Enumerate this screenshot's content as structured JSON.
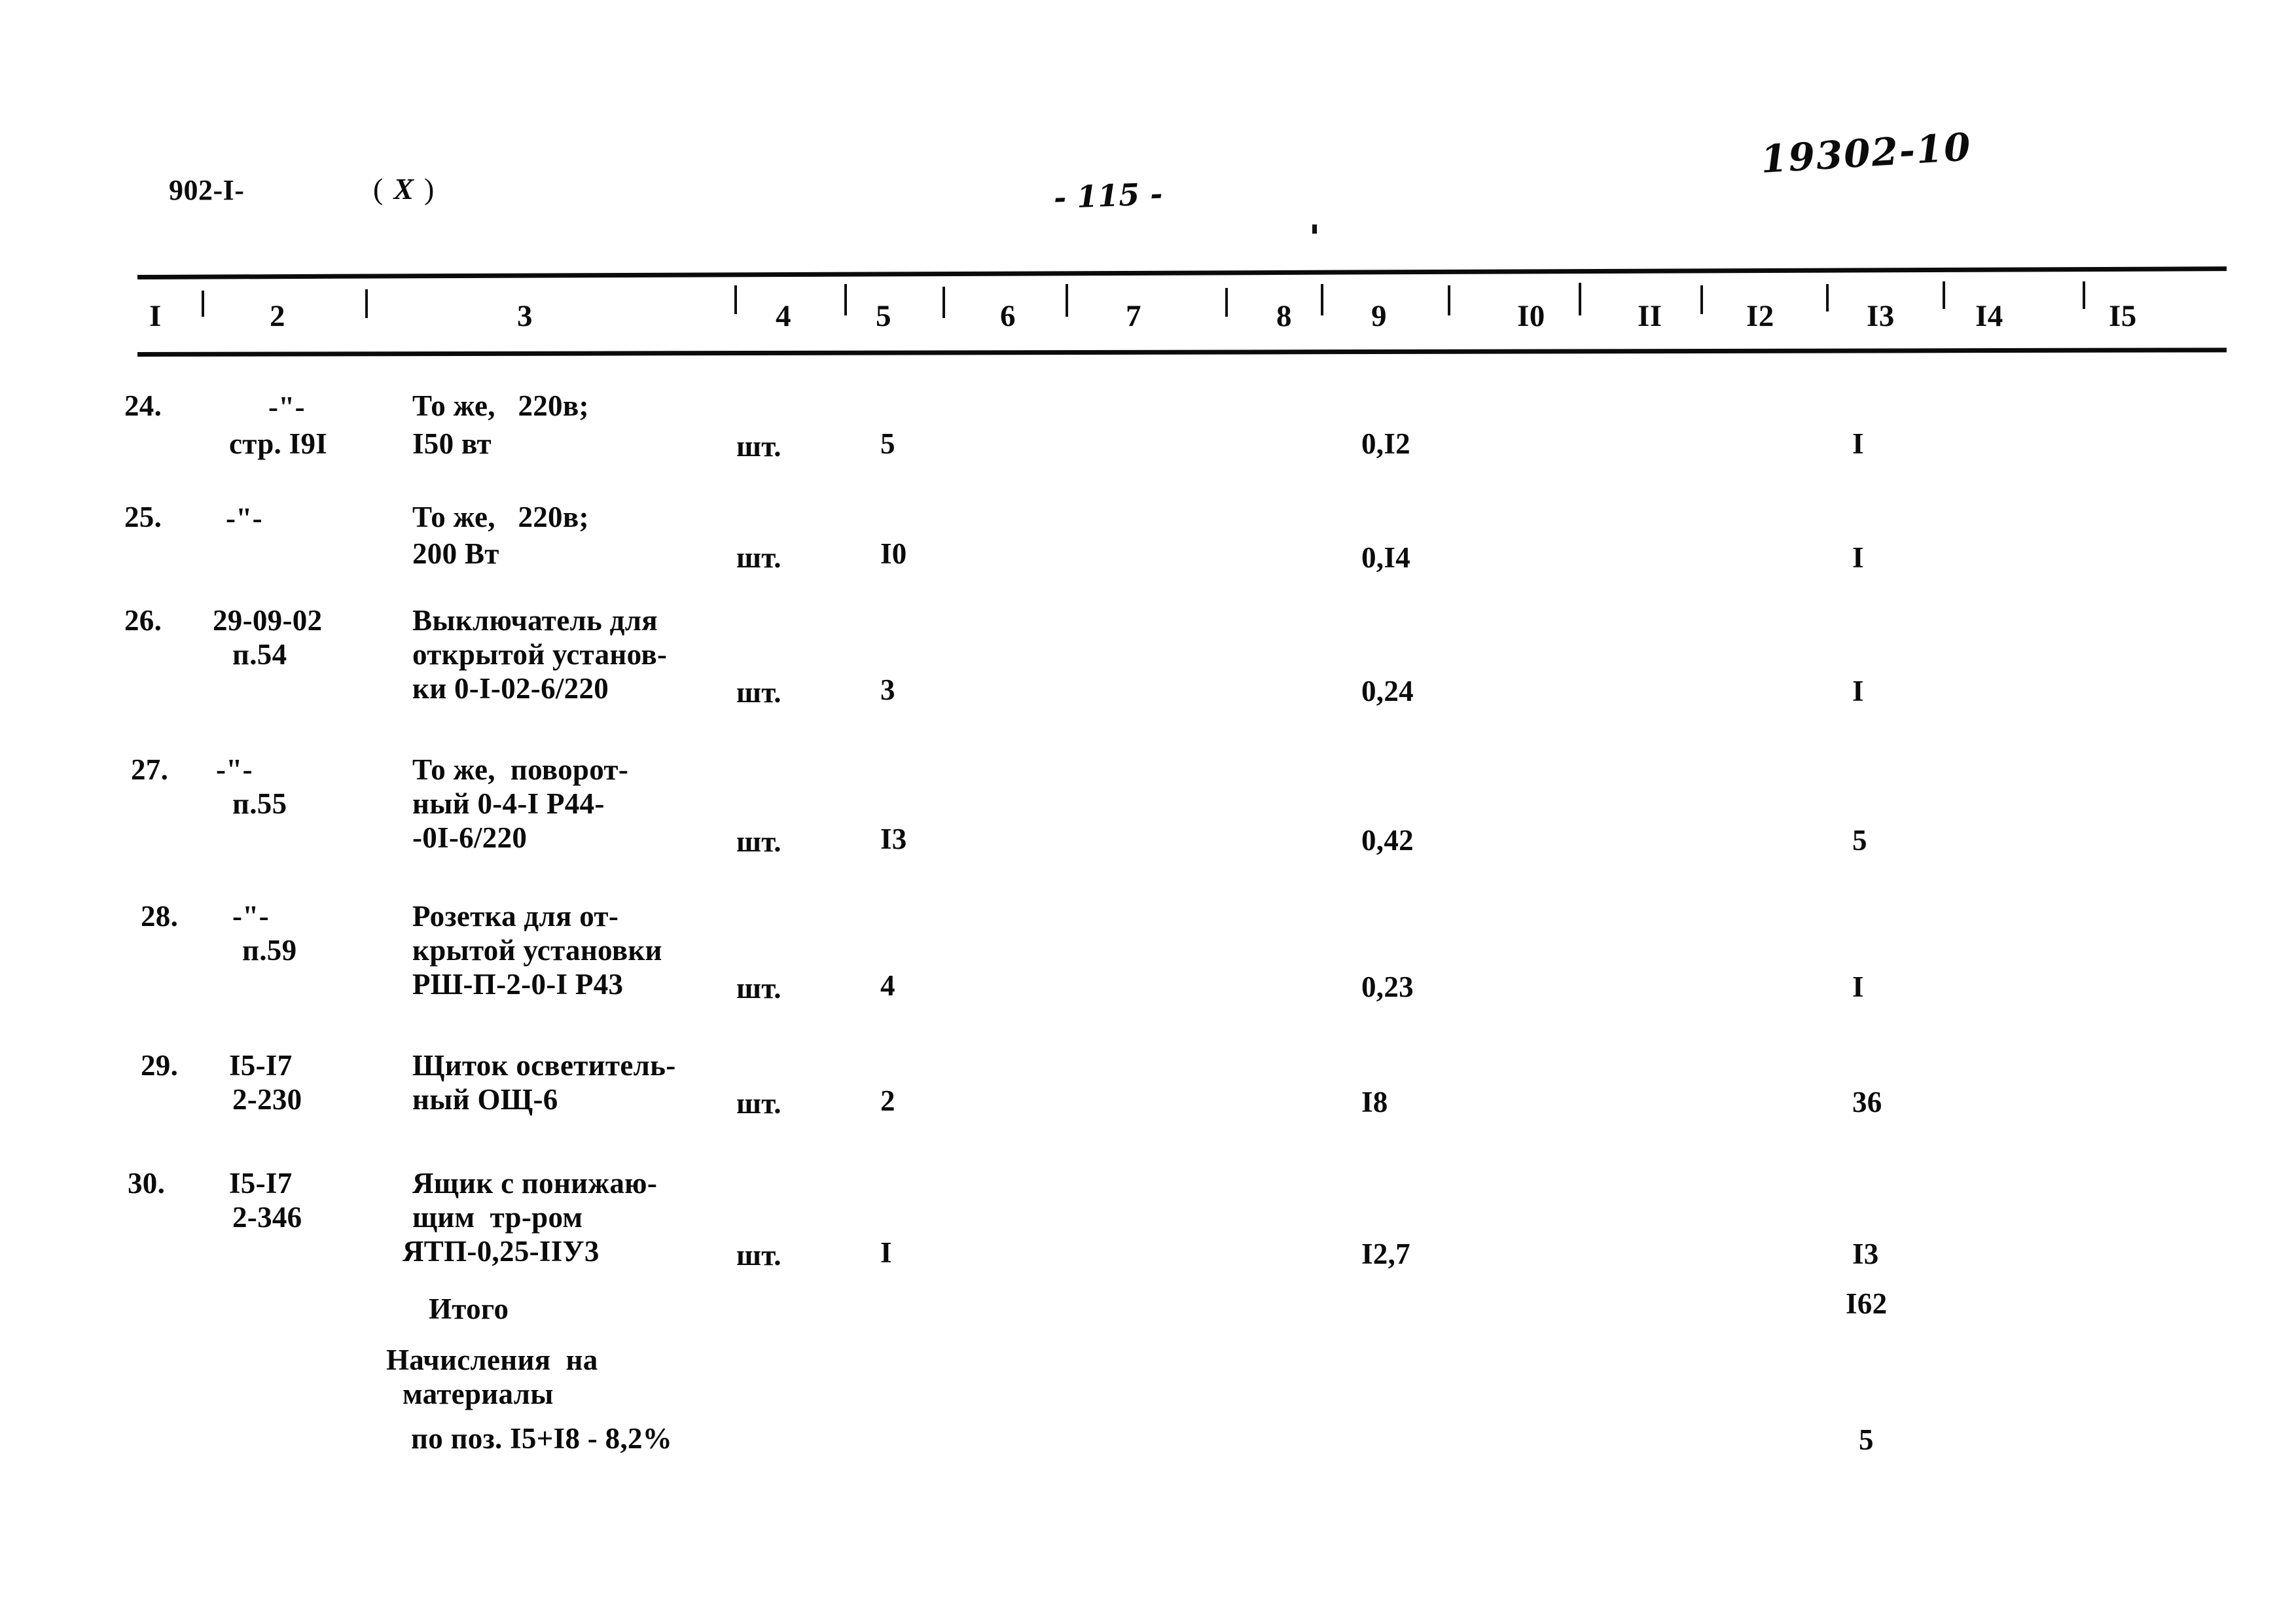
{
  "header": {
    "doc_code": "902-I-",
    "variant_open": "(",
    "variant_value": "X",
    "variant_close": ")",
    "page_number": "- 115 -",
    "hand_number": "19302-10"
  },
  "table": {
    "column_headers": [
      "I",
      "2",
      "3",
      "4",
      "5",
      "6",
      "7",
      "8",
      "9",
      "I0",
      "II",
      "I2",
      "I3",
      "I4",
      "I5"
    ],
    "rows": [
      {
        "num": "24.",
        "code_line1": "-\"-",
        "code_line2": "стр. I9I",
        "name_line1": "То же,   220в;",
        "name_line2": "I50 вт",
        "name_line3": "",
        "unit": "шт.",
        "qty": "5",
        "col9": "0,I2",
        "col13": "I"
      },
      {
        "num": "25.",
        "code_line1": "-\"-",
        "code_line2": "",
        "name_line1": "То же,   220в;",
        "name_line2": "200 Вт",
        "name_line3": "",
        "unit": "шт.",
        "qty": "I0",
        "col9": "0,I4",
        "col13": "I"
      },
      {
        "num": "26.",
        "code_line1": "29-09-02",
        "code_line2": "п.54",
        "name_line1": "Выключатель для",
        "name_line2": "открытой установ-",
        "name_line3": "ки 0-I-02-6/220",
        "unit": "шт.",
        "qty": "3",
        "col9": "0,24",
        "col13": "I"
      },
      {
        "num": "27.",
        "code_line1": "-\"-",
        "code_line2": "п.55",
        "name_line1": "То же,  поворот-",
        "name_line2": "ный 0-4-I Р44-",
        "name_line3": "-0I-6/220",
        "unit": "шт.",
        "qty": "I3",
        "col9": "0,42",
        "col13": "5"
      },
      {
        "num": "28.",
        "code_line1": "-\"-",
        "code_line2": "п.59",
        "name_line1": "Розетка для от-",
        "name_line2": "крытой установки",
        "name_line3": "РШ-П-2-0-I Р43",
        "unit": "шт.",
        "qty": "4",
        "col9": "0,23",
        "col13": "I"
      },
      {
        "num": "29.",
        "code_line1": "I5-I7",
        "code_line2": "2-230",
        "name_line1": "Щиток осветитель-",
        "name_line2": "ный ОЩ-6",
        "name_line3": "",
        "unit": "шт.",
        "qty": "2",
        "col9": "I8",
        "col13": "36"
      },
      {
        "num": "30.",
        "code_line1": "I5-I7",
        "code_line2": "2-346",
        "name_line1": "Ящик с понижаю-",
        "name_line2": "щим  тр-ром",
        "name_line3": "ЯТП-0,25-IIУ3",
        "unit": "шт.",
        "qty": "I",
        "col9": "I2,7",
        "col13": "I3"
      }
    ],
    "summary": [
      {
        "label": "Итого",
        "col13": "I62"
      },
      {
        "label_line1": "Начисления  на",
        "label_line2": "материалы",
        "label_line3": "по поз. I5+I8 - 8,2%",
        "col13": "5"
      }
    ]
  }
}
